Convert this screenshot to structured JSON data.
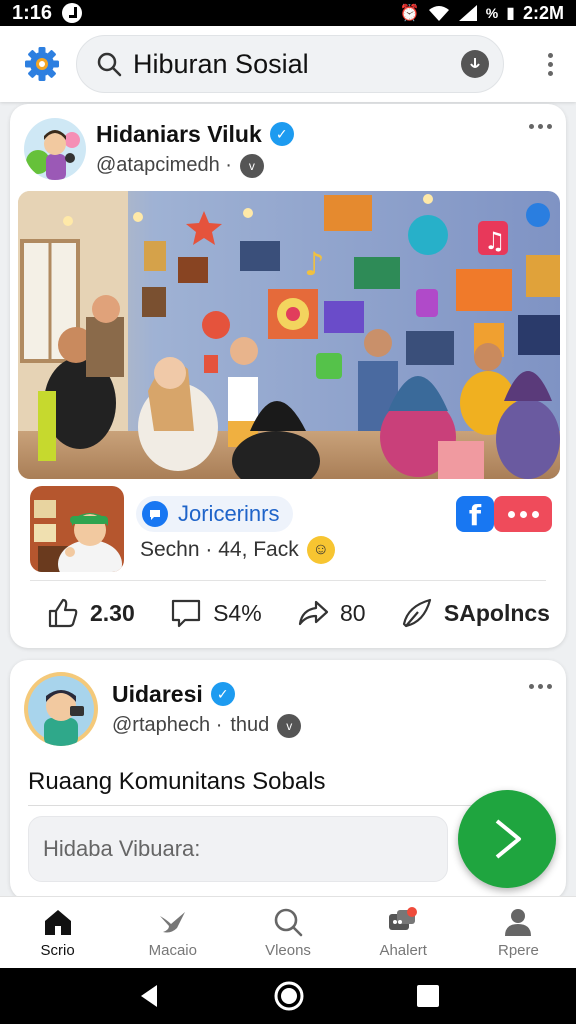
{
  "status_bar": {
    "time": "1:16",
    "battery": "%",
    "clock": "2:2M"
  },
  "app_bar": {
    "search_text": "Hiburan Sosial",
    "icons": [
      "settings-gear-icon",
      "search-icon",
      "mic-icon",
      "more-vert-icon"
    ]
  },
  "post1": {
    "author": "Hidaniars Viluk",
    "handle": "@atapcimedh ·",
    "chip_label": "Joricerinrs",
    "caption": "Sechn · 44, Fack",
    "facebook_letter": "f",
    "actions": {
      "like_count": "2.30",
      "comment_count": "S4%",
      "share_count": "80",
      "send_label": "SApolncs"
    }
  },
  "post2": {
    "author": "Uidaresi",
    "handle": "@rtaphech ·",
    "handle_suffix": "thud",
    "text": "Ruaang Komunitans Sobals",
    "comment_placeholder": "Hidaba Vibuara:"
  },
  "bottom_nav": {
    "items": [
      {
        "label": "Scrio",
        "icon": "home-icon",
        "active": true
      },
      {
        "label": "Macaio",
        "icon": "bird-icon",
        "active": false
      },
      {
        "label": "Vleons",
        "icon": "search-icon",
        "active": false
      },
      {
        "label": "Ahalert",
        "icon": "chat-alert-icon",
        "active": false
      },
      {
        "label": "Rpere",
        "icon": "profile-icon",
        "active": false
      }
    ]
  },
  "colors": {
    "accent_blue": "#1d9bf0",
    "facebook_blue": "#1877f2",
    "fab_green": "#1fa53f",
    "red_button": "#ef4b5b"
  }
}
